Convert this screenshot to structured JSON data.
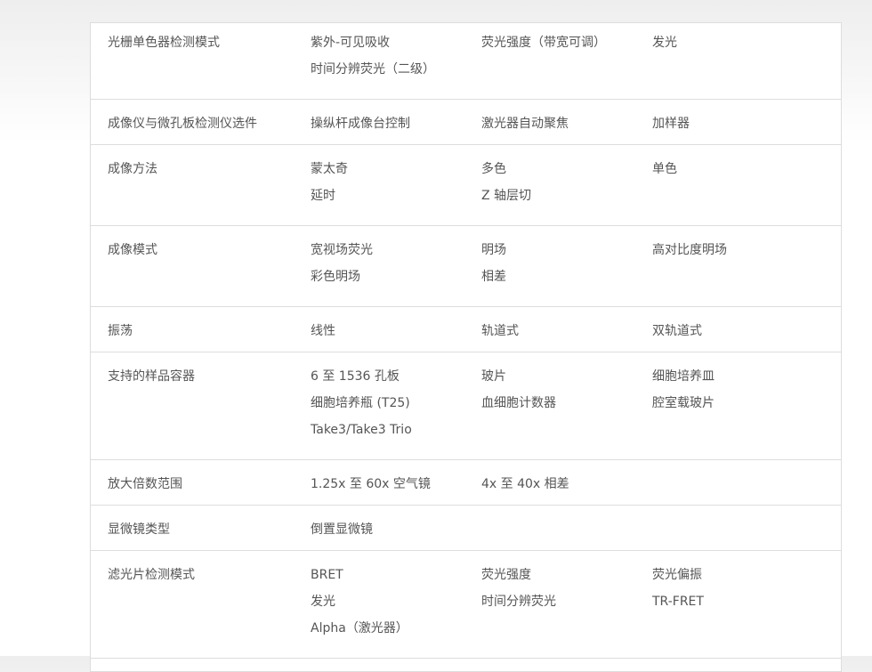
{
  "spec_rows": [
    {
      "label": "光栅单色器检测模式",
      "col1": [
        "紫外-可见吸收",
        "时间分辨荧光（二级）"
      ],
      "col2": [
        "荧光强度（带宽可调）"
      ],
      "col3": [
        "发光"
      ]
    },
    {
      "label": "成像仪与微孔板检测仪选件",
      "col1": [
        "操纵杆成像台控制"
      ],
      "col2": [
        "激光器自动聚焦"
      ],
      "col3": [
        "加样器"
      ]
    },
    {
      "label": "成像方法",
      "col1": [
        "蒙太奇",
        "延时"
      ],
      "col2": [
        "多色",
        "Z 轴层切"
      ],
      "col3": [
        "单色"
      ]
    },
    {
      "label": "成像模式",
      "col1": [
        "宽视场荧光",
        "彩色明场"
      ],
      "col2": [
        "明场",
        "相差"
      ],
      "col3": [
        "高对比度明场"
      ]
    },
    {
      "label": "振荡",
      "col1": [
        "线性"
      ],
      "col2": [
        "轨道式"
      ],
      "col3": [
        "双轨道式"
      ]
    },
    {
      "label": "支持的样品容器",
      "col1": [
        "6 至 1536 孔板",
        "细胞培养瓶 (T25)",
        "Take3/Take3 Trio"
      ],
      "col2": [
        "玻片",
        "血细胞计数器"
      ],
      "col3": [
        "细胞培养皿",
        "腔室载玻片"
      ]
    },
    {
      "label": "放大倍数范围",
      "col1": [
        "1.25x 至 60x 空气镜"
      ],
      "col2": [
        "4x 至 40x 相差"
      ],
      "col3": []
    },
    {
      "label": "显微镜类型",
      "col1": [
        "倒置显微镜"
      ],
      "col2": [],
      "col3": []
    },
    {
      "label": "滤光片检测模式",
      "col1": [
        "BRET",
        "发光",
        "Alpha（激光器）"
      ],
      "col2": [
        "荧光强度",
        "时间分辨荧光"
      ],
      "col3": [
        "荧光偏振",
        "TR-FRET"
      ]
    }
  ]
}
